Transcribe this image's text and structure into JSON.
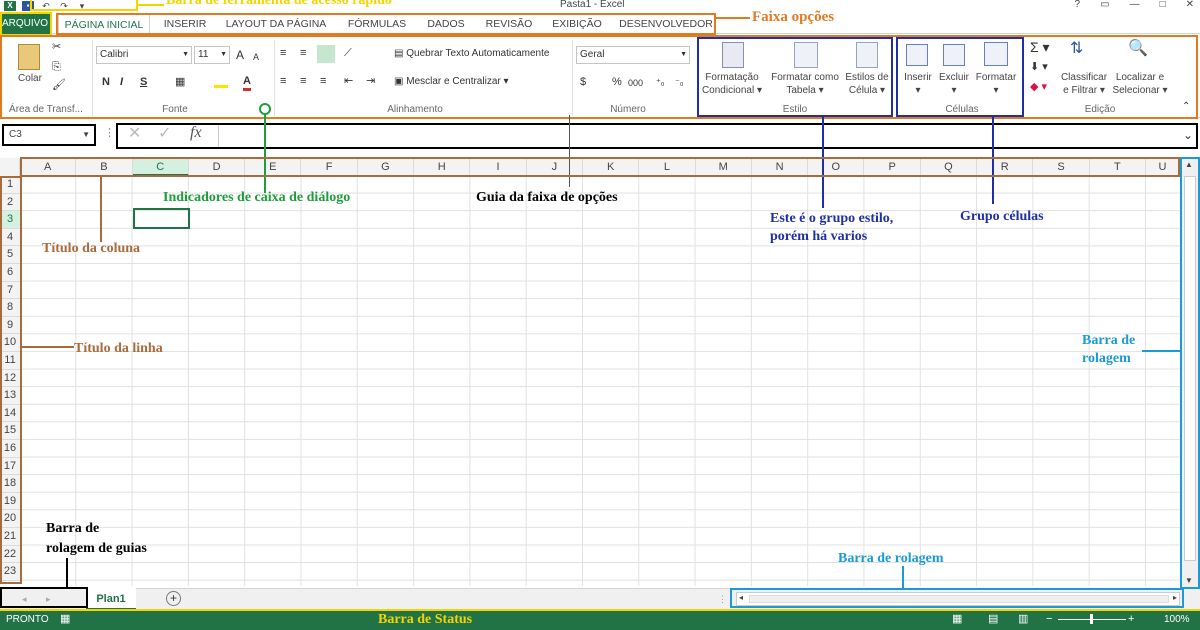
{
  "title_bar": {
    "doc_title": "Pasta1 - Excel",
    "help": "?",
    "minimize": "—",
    "close": "✕",
    "restore": "□",
    "ribbon_display": "▭"
  },
  "qat": {
    "excel": "X",
    "save": "💾",
    "undo": "↶",
    "redo": "↷",
    "more": "▾"
  },
  "tabs": {
    "file": "ARQUIVO",
    "home": "PÁGINA INICIAL",
    "insert": "INSERIR",
    "layout": "LAYOUT DA PÁGINA",
    "formulas": "FÓRMULAS",
    "data": "DADOS",
    "review": "REVISÃO",
    "view": "EXIBIÇÃO",
    "developer": "DESENVOLVEDOR"
  },
  "ribbon": {
    "clipboard": {
      "paste": "Colar",
      "label": "Área de Transf..."
    },
    "font": {
      "name": "Calibri",
      "size": "11",
      "bold": "N",
      "italic": "I",
      "underline": "S",
      "grow": "A",
      "shrink": "A",
      "label": "Fonte"
    },
    "alignment": {
      "wrap": "Quebrar Texto Automaticamente",
      "merge": "Mesclar e Centralizar",
      "label": "Alinhamento"
    },
    "number": {
      "format": "Geral",
      "percent": "%",
      "comma": "000",
      "label": "Número"
    },
    "styles": {
      "cond1": "Formatação",
      "cond2": "Condicional",
      "table1": "Formatar como",
      "table2": "Tabela",
      "cell1": "Estilos de",
      "cell2": "Célula",
      "label": "Estilo"
    },
    "cells": {
      "insert": "Inserir",
      "delete": "Excluir",
      "format": "Formatar",
      "label": "Células"
    },
    "editing": {
      "sort1": "Classificar",
      "sort2": "e Filtrar",
      "find1": "Localizar e",
      "find2": "Selecionar",
      "label": "Edição"
    }
  },
  "formula_bar": {
    "name_box": "C3",
    "cancel": "✕",
    "enter": "✓",
    "fx": "fx",
    "value": ""
  },
  "columns": [
    "A",
    "B",
    "C",
    "D",
    "E",
    "F",
    "G",
    "H",
    "I",
    "J",
    "K",
    "L",
    "M",
    "N",
    "O",
    "P",
    "Q",
    "R",
    "S",
    "T",
    "U"
  ],
  "rows": [
    "1",
    "2",
    "3",
    "4",
    "5",
    "6",
    "7",
    "8",
    "9",
    "10",
    "11",
    "12",
    "13",
    "14",
    "15",
    "16",
    "17",
    "18",
    "19",
    "20",
    "21",
    "22",
    "23"
  ],
  "active_cell": "C3",
  "sheet_tabs": {
    "sheet1": "Plan1",
    "add": "+"
  },
  "status": {
    "ready": "PRONTO",
    "zoom": "100%"
  },
  "annotations": {
    "qat": "Barra de ferramenta de acesso rápido",
    "ribbon": "Faixa opções",
    "dialog": "Indicadores de caixa de diálogo",
    "ribbon_tab": "Guia da faixa de opções",
    "column_title": "Título da coluna",
    "row_title": "Título da linha",
    "style_group": "Este é o grupo estilo, porém há varios",
    "cells_group": "Grupo células",
    "vscroll1": "Barra de",
    "vscroll2": "rolagem",
    "tab_scroll1": "Barra de",
    "tab_scroll2": "rolagem de guias",
    "hscroll": "Barra de rolagem",
    "statusbar": "Barra de Status"
  },
  "colors": {
    "excel_green": "#217346",
    "annot_orange": "#e07b22",
    "annot_blue": "#1f2fa8",
    "annot_cyan": "#1b9ad6",
    "annot_brown": "#a86b3c",
    "annot_yellow": "#f5d400",
    "annot_green": "#1e9e3a"
  }
}
